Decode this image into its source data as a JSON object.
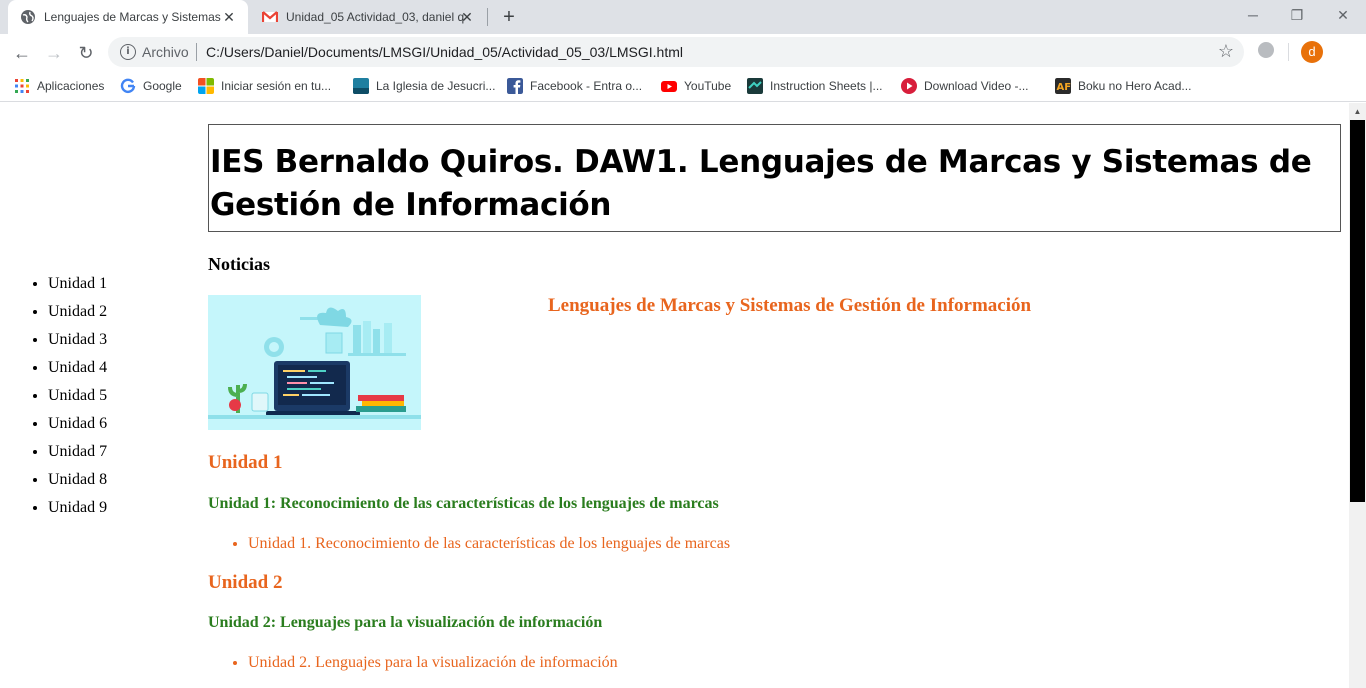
{
  "browser": {
    "tabs": [
      {
        "title": "Lenguajes de Marcas y Sistemas",
        "active": true
      },
      {
        "title": "Unidad_05 Actividad_03, daniel q",
        "active": false
      }
    ],
    "new_tab": "+",
    "window_controls": {
      "minimize": "─",
      "restore": "❐",
      "close": "✕"
    },
    "nav": {
      "back": "←",
      "forward": "→",
      "reload": "↻"
    },
    "address_bar": {
      "info_icon": "i",
      "scheme_label": "Archivo",
      "url": "C:/Users/Daniel/Documents/LMSGI/Unidad_05/Actividad_05_03/LMSGI.html",
      "star": "☆"
    },
    "profile_initial": "d",
    "menu_icon": "⋮",
    "bookmarks": [
      {
        "label": "Aplicaciones",
        "icon": "apps-grid-icon",
        "color": "#4285f4"
      },
      {
        "label": "Google",
        "icon": "google-icon",
        "color": "#4285f4"
      },
      {
        "label": "Iniciar sesión en tu...",
        "icon": "microsoft-icon",
        "color": "#f25022"
      },
      {
        "label": "La Iglesia de Jesucri...",
        "icon": "church-icon",
        "color": "#1f7fa0"
      },
      {
        "label": "Facebook - Entra o...",
        "icon": "facebook-icon",
        "color": "#3b5998"
      },
      {
        "label": "YouTube",
        "icon": "youtube-icon",
        "color": "#ff0000"
      },
      {
        "label": "Instruction Sheets |...",
        "icon": "instructions-icon",
        "color": "#1a3a3a"
      },
      {
        "label": "Download Video -...",
        "icon": "download-video-icon",
        "color": "#d81e3b"
      },
      {
        "label": "Boku no Hero Acad...",
        "icon": "animeflv-icon",
        "color": "#2b2b2b"
      }
    ]
  },
  "page": {
    "header_title": "IES Bernaldo Quiros. DAW1. Lenguajes de Marcas y Sistemas de Gestión de Información",
    "nav_items": [
      "Unidad 1",
      "Unidad 2",
      "Unidad 3",
      "Unidad 4",
      "Unidad 5",
      "Unidad 6",
      "Unidad 7",
      "Unidad 8",
      "Unidad 9"
    ],
    "news_heading": "Noticias",
    "subject_title": "Lenguajes de Marcas y Sistemas de Gestión de Información",
    "units": [
      {
        "heading": "Unidad 1",
        "subtitle": "Unidad 1: Reconocimiento de las características de los lenguajes de marcas",
        "link": "Unidad 1. Reconocimiento de las características de los lenguajes de marcas"
      },
      {
        "heading": "Unidad 2",
        "subtitle": "Unidad 2: Lenguajes para la visualización de información",
        "link": "Unidad 2. Lenguajes para la visualización de información"
      }
    ]
  },
  "colors": {
    "accent_orange": "#e8651e",
    "subtitle_green": "#2a7d1e",
    "illustration_bg": "#c5f6fb"
  }
}
